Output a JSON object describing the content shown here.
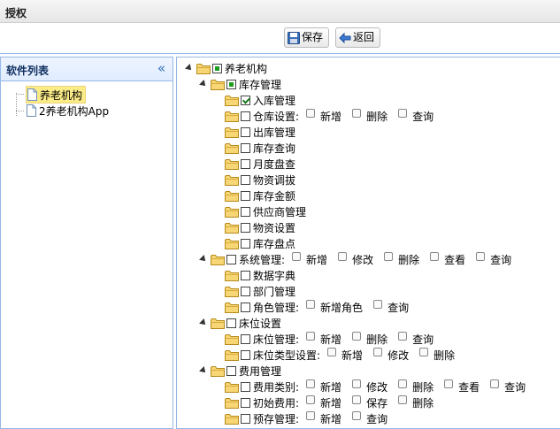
{
  "title": "授权",
  "toolbar": {
    "save_label": "保存",
    "back_label": "返回"
  },
  "left_panel": {
    "header": "软件列表",
    "collapse_glyph": "«",
    "items": [
      {
        "label": "养老机构"
      },
      {
        "label": "2养老机构App"
      }
    ]
  },
  "tree": {
    "root": "养老机构",
    "inventory": {
      "label": "库存管理",
      "items": [
        {
          "label": "入库管理"
        },
        {
          "label": "仓库设置:",
          "perms": [
            "新增",
            "删除",
            "查询"
          ]
        },
        {
          "label": "出库管理"
        },
        {
          "label": "库存查询"
        },
        {
          "label": "月度盘查"
        },
        {
          "label": "物资调拔"
        },
        {
          "label": "库存金额"
        },
        {
          "label": "供应商管理"
        },
        {
          "label": "物资设置"
        },
        {
          "label": "库存盘点"
        }
      ]
    },
    "system": {
      "label": "系统管理:",
      "perms": [
        "新增",
        "修改",
        "删除",
        "查看",
        "查询"
      ],
      "items": [
        {
          "label": "数据字典"
        },
        {
          "label": "部门管理"
        },
        {
          "label": "角色管理:",
          "perms": [
            "新增角色",
            "查询"
          ]
        }
      ]
    },
    "bed": {
      "label": "床位设置",
      "items": [
        {
          "label": "床位管理:",
          "perms": [
            "新增",
            "删除",
            "查询"
          ]
        },
        {
          "label": "床位类型设置:",
          "perms": [
            "新增",
            "修改",
            "删除"
          ]
        }
      ]
    },
    "fee": {
      "label": "费用管理",
      "items": [
        {
          "label": "费用类别:",
          "perms": [
            "新增",
            "修改",
            "删除",
            "查看",
            "查询"
          ]
        },
        {
          "label": "初始费用:",
          "perms": [
            "新增",
            "保存",
            "删除"
          ]
        },
        {
          "label": "预存管理:",
          "perms": [
            "新增",
            "查询"
          ]
        }
      ]
    }
  }
}
